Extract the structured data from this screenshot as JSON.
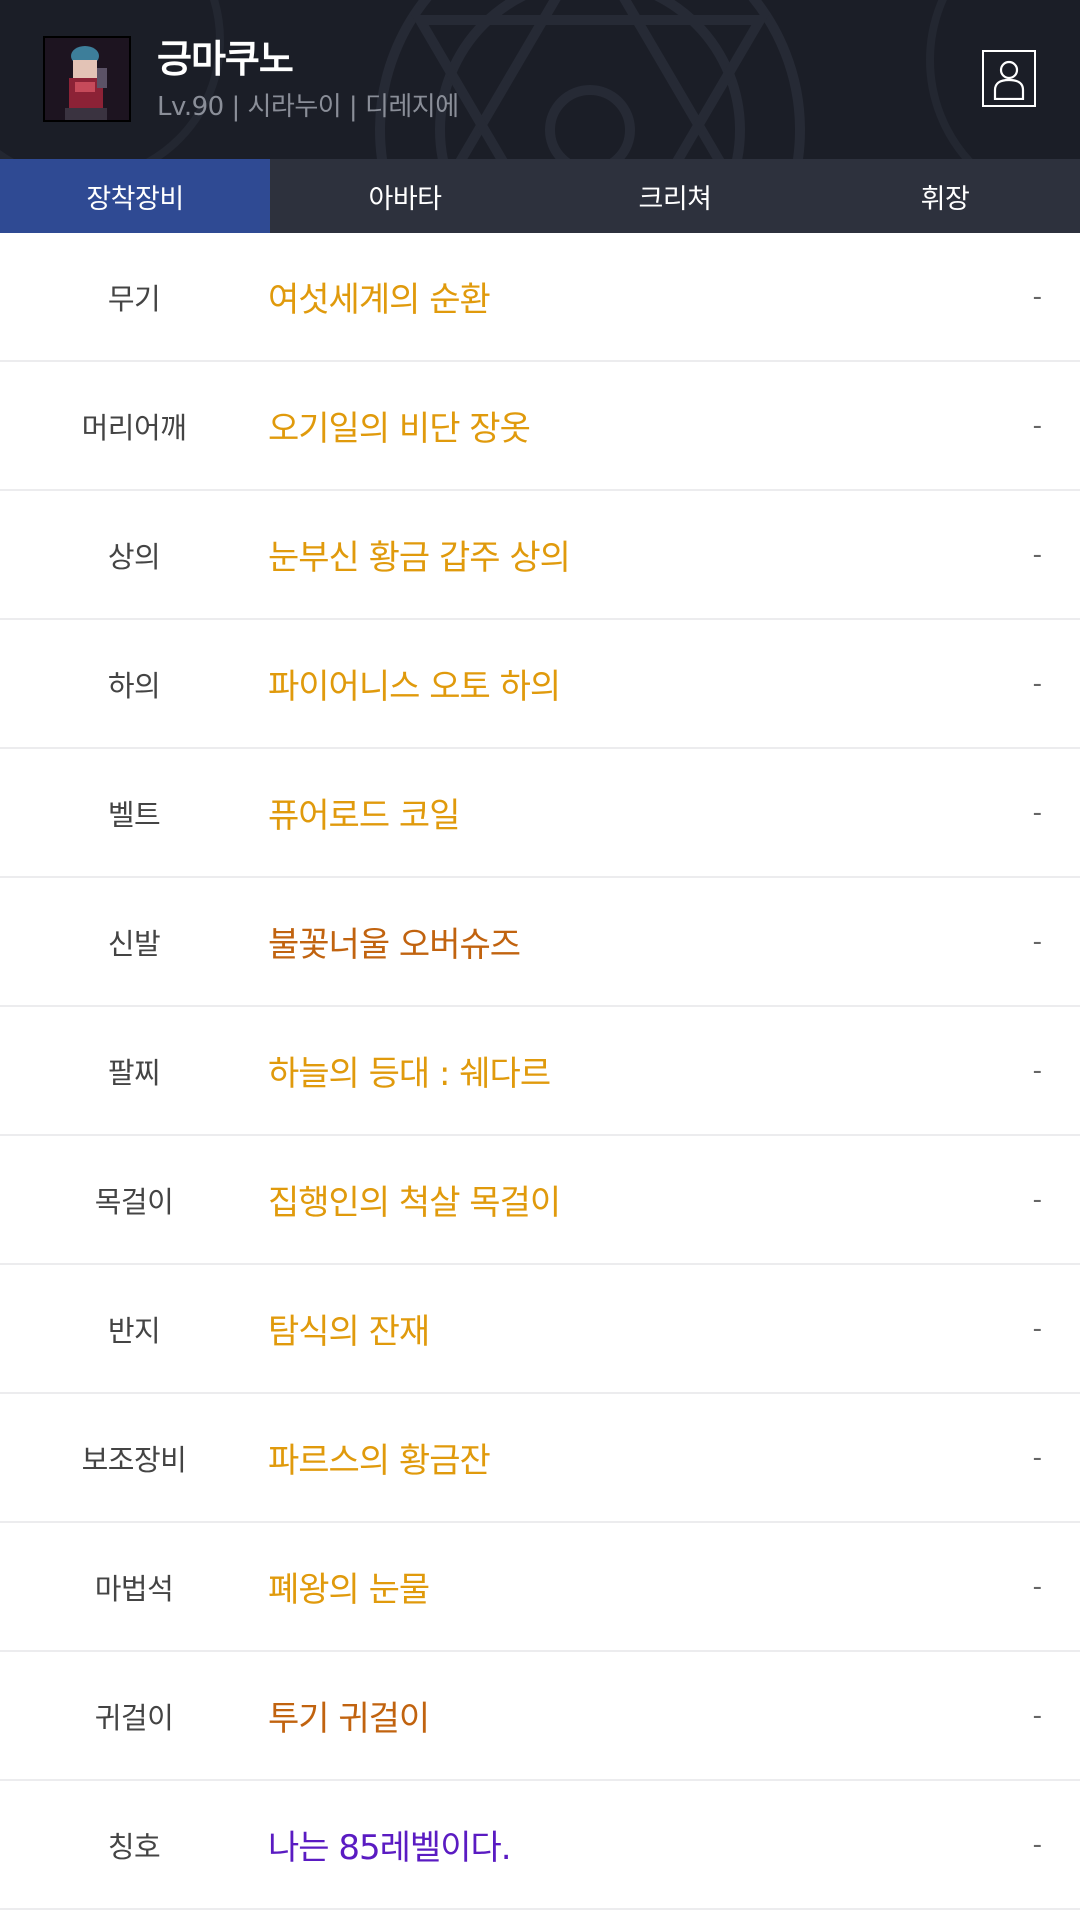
{
  "header": {
    "name": "긍마쿠노",
    "info": "Lv.90 | 시라누이 | 디레지에",
    "avatar_icon": "character-avatar",
    "profile_icon": "person-icon"
  },
  "tabs": [
    {
      "label": "장착장비",
      "active": true
    },
    {
      "label": "아바타",
      "active": false
    },
    {
      "label": "크리쳐",
      "active": false
    },
    {
      "label": "휘장",
      "active": false
    }
  ],
  "colors": {
    "epic": "#e09a0c",
    "legendary": "#c1630f",
    "unique": "#5a1bc2",
    "active_tab": "#2f4a93"
  },
  "equipment": [
    {
      "slot": "무기",
      "item": "여섯세계의 순환",
      "grade": "epic",
      "value": "-"
    },
    {
      "slot": "머리어깨",
      "item": "오기일의 비단 장옷",
      "grade": "epic",
      "value": "-"
    },
    {
      "slot": "상의",
      "item": "눈부신 황금 갑주 상의",
      "grade": "epic",
      "value": "-"
    },
    {
      "slot": "하의",
      "item": "파이어니스 오토 하의",
      "grade": "epic",
      "value": "-"
    },
    {
      "slot": "벨트",
      "item": "퓨어로드 코일",
      "grade": "epic",
      "value": "-"
    },
    {
      "slot": "신발",
      "item": "불꽃너울 오버슈즈",
      "grade": "legendary",
      "value": "-"
    },
    {
      "slot": "팔찌",
      "item": "하늘의 등대 : 쉐다르",
      "grade": "epic",
      "value": "-"
    },
    {
      "slot": "목걸이",
      "item": "집행인의 척살 목걸이",
      "grade": "epic",
      "value": "-"
    },
    {
      "slot": "반지",
      "item": "탐식의 잔재",
      "grade": "epic",
      "value": "-"
    },
    {
      "slot": "보조장비",
      "item": "파르스의 황금잔",
      "grade": "epic",
      "value": "-"
    },
    {
      "slot": "마법석",
      "item": "폐왕의 눈물",
      "grade": "epic",
      "value": "-"
    },
    {
      "slot": "귀걸이",
      "item": "투기 귀걸이",
      "grade": "legendary",
      "value": "-"
    },
    {
      "slot": "칭호",
      "item": "나는 85레벨이다.",
      "grade": "unique",
      "value": "-"
    }
  ]
}
